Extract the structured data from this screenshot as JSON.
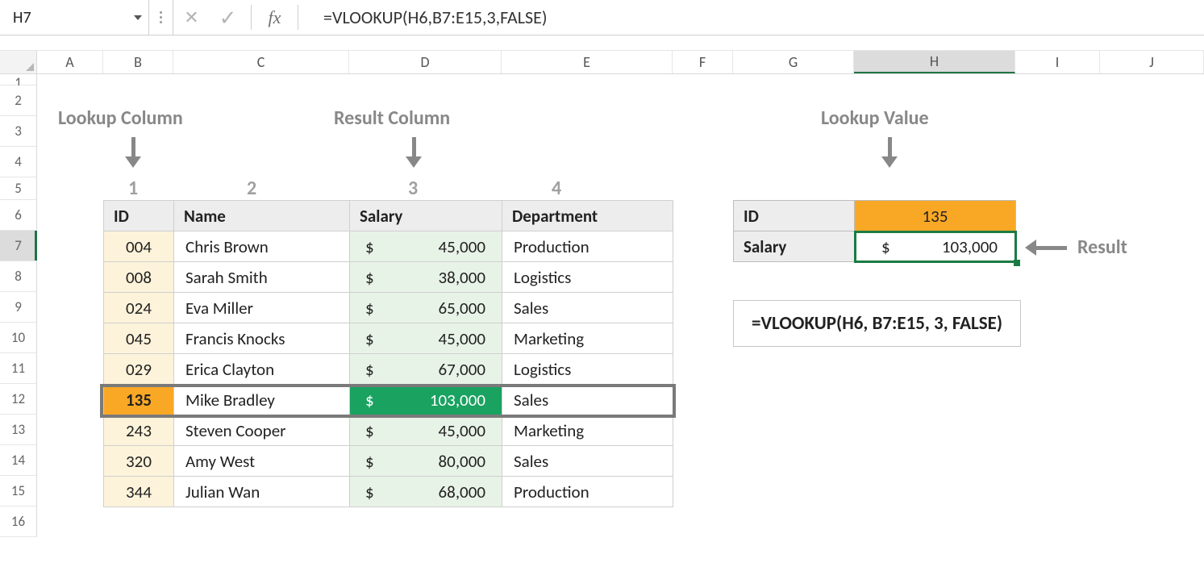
{
  "namebox": {
    "value": "H7"
  },
  "formula_bar": {
    "cancel_glyph": "✕",
    "accept_glyph": "✓",
    "fx_label": "fx",
    "formula": "=VLOOKUP(H6,B7:E15,3,FALSE)"
  },
  "columns": [
    "A",
    "B",
    "C",
    "D",
    "E",
    "F",
    "G",
    "H",
    "I",
    "J"
  ],
  "active_column_index": 7,
  "rows": [
    "1",
    "2",
    "3",
    "4",
    "5",
    "6",
    "7",
    "8",
    "9",
    "10",
    "11",
    "12",
    "13",
    "14",
    "15",
    "16"
  ],
  "active_row_index": 6,
  "annotations": {
    "lookup_column": "Lookup Column",
    "result_column": "Result Column",
    "lookup_value": "Lookup Value",
    "result": "Result",
    "col_numbers": [
      "1",
      "2",
      "3",
      "4"
    ]
  },
  "table": {
    "headers": {
      "id": "ID",
      "name": "Name",
      "salary": "Salary",
      "dept": "Department"
    },
    "rows": [
      {
        "id": "004",
        "name": "Chris Brown",
        "salary": "45,000",
        "dept": "Production"
      },
      {
        "id": "008",
        "name": "Sarah Smith",
        "salary": "38,000",
        "dept": "Logistics"
      },
      {
        "id": "024",
        "name": "Eva Miller",
        "salary": "65,000",
        "dept": "Sales"
      },
      {
        "id": "045",
        "name": "Francis Knocks",
        "salary": "45,000",
        "dept": "Marketing"
      },
      {
        "id": "029",
        "name": "Erica Clayton",
        "salary": "67,000",
        "dept": "Logistics"
      },
      {
        "id": "135",
        "name": "Mike Bradley",
        "salary": "103,000",
        "dept": "Sales",
        "highlight": true
      },
      {
        "id": "243",
        "name": "Steven Cooper",
        "salary": "45,000",
        "dept": "Marketing"
      },
      {
        "id": "320",
        "name": "Amy West",
        "salary": "80,000",
        "dept": "Sales"
      },
      {
        "id": "344",
        "name": "Julian Wan",
        "salary": "68,000",
        "dept": "Production"
      }
    ]
  },
  "lookup_box": {
    "id_label": "ID",
    "id_value": "135",
    "salary_label": "Salary",
    "salary_value": "103,000"
  },
  "formula_display": "=VLOOKUP(H6, B7:E15, 3, FALSE)",
  "dollar": "$"
}
